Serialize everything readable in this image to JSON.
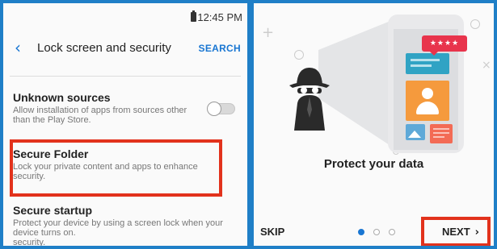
{
  "left": {
    "status_time": "12:45 PM",
    "title": "Lock screen and security",
    "search_label": "SEARCH",
    "items": [
      {
        "title": "Unknown sources",
        "desc": "Allow installation of apps from sources other than the Play Store."
      },
      {
        "title": "Secure Folder",
        "desc": "Lock your private content and apps to enhance security."
      },
      {
        "title": "Secure startup",
        "desc": "Protect your device by using a screen lock when your device turns on.",
        "desc_cont": "security."
      }
    ],
    "toggle_state": "off"
  },
  "right": {
    "stars": "★★★★",
    "protect_text": "Protect your data",
    "skip_label": "SKIP",
    "next_label": "NEXT",
    "next_icon": "chevron-right-icon",
    "page_count": 3,
    "current_page": 1
  },
  "colors": {
    "highlight": "#e2321c",
    "accent": "#1976d2",
    "background": "#1f7fc7"
  }
}
